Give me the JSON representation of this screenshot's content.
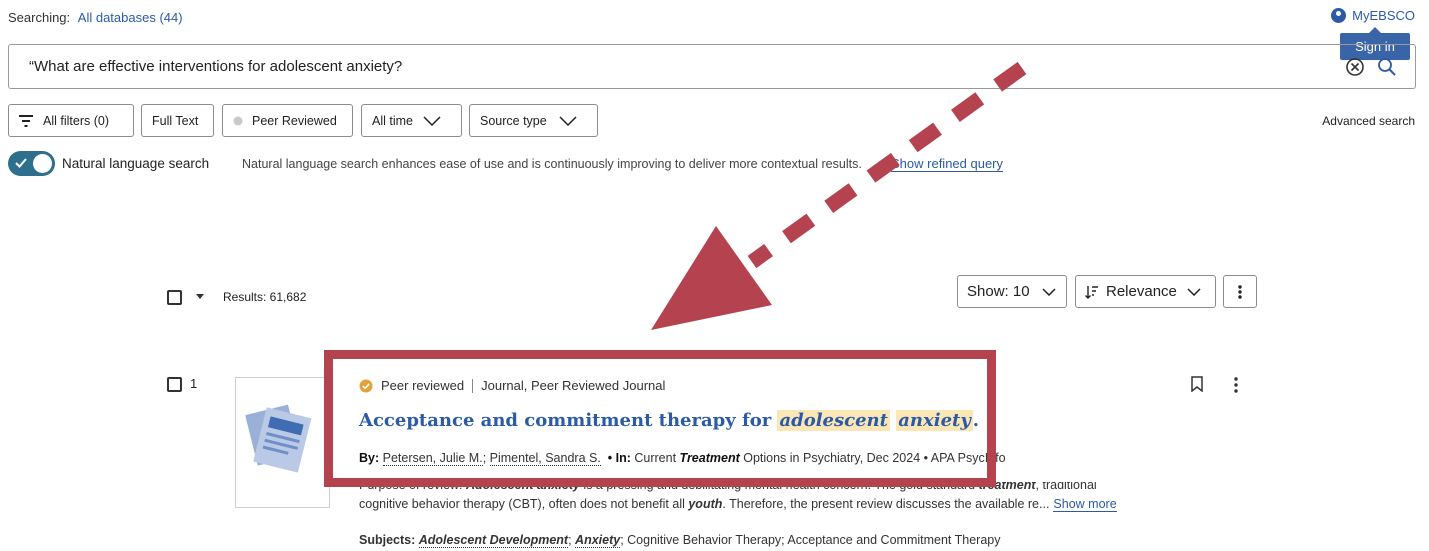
{
  "header": {
    "searching_label": "Searching:",
    "databases_link": "All databases (44)",
    "myebsco_label": "MyEBSCO",
    "sign_in_tooltip": "Sign in"
  },
  "search": {
    "query": "“What are effective interventions for adolescent anxiety?"
  },
  "filters": {
    "all_filters": "All filters (0)",
    "full_text": "Full Text",
    "peer_reviewed": "Peer Reviewed",
    "date_range": "All time",
    "source_type": "Source type",
    "advanced_search": "Advanced search"
  },
  "natural_language": {
    "enabled": true,
    "label": "Natural language search",
    "description": "Natural language search enhances ease of use and is continuously improving to deliver more contextual results.",
    "refined_query_link": "Show refined query"
  },
  "results": {
    "count_label": "Results: 61,682",
    "show_label": "Show: 10",
    "sort_label": "Relevance",
    "items": [
      {
        "rank": "1",
        "badge": "Peer reviewed",
        "source_types": "Journal, Peer Reviewed Journal",
        "title_prefix": "Acceptance and commitment therapy for ",
        "title_hl1": "adolescent",
        "title_hl2": "anxiety",
        "title_suffix": ".",
        "by_label": "By:",
        "author1": "Petersen, Julie M.",
        "author_sep": "; ",
        "author2": "Pimentel, Sandra S.",
        "in_label": "• In:",
        "pub_pre": " Current ",
        "pub_hl": "Treatment",
        "pub_post": " Options in Psychiatry, Dec 2024 • APA PsycInfo",
        "abstract_line1_a": "Purpose of review: ",
        "abstract_line1_hl1": "Adolescent anxiety",
        "abstract_line1_b": " is a pressing and debilitating mental health concern. The gold standard ",
        "abstract_line1_hl2": "treatment",
        "abstract_line1_c": ", traditional",
        "abstract_line2_a": "cognitive behavior therapy (CBT), often does not benefit all ",
        "abstract_line2_hl": "youth",
        "abstract_line2_b": ". Therefore, the present review discusses the available re...",
        "show_more": "Show more",
        "subjects_label": "Subjects:",
        "subject1": "Adolescent Development",
        "subject2": "Anxiety",
        "subject_rest": "; Cognitive Behavior Therapy; Acceptance and Commitment Therapy"
      }
    ]
  },
  "annotation": {
    "color": "#b5434f"
  }
}
